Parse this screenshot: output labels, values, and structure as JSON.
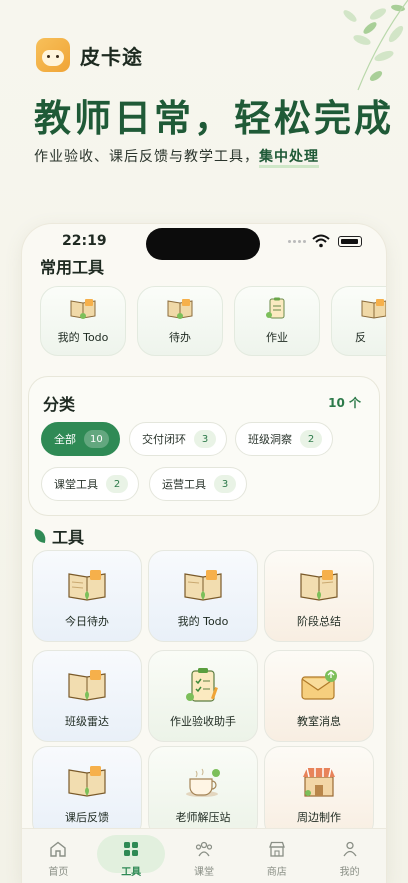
{
  "brand": {
    "name": "皮卡途"
  },
  "hero": {
    "headline": "教师日常，轻松完成",
    "subline_prefix": "作业验收、课后反馈与教学工具，",
    "subline_highlight": "集中处理"
  },
  "status_bar": {
    "time": "22:19"
  },
  "common_tools": {
    "title": "常用工具",
    "items": [
      {
        "label": "我的 Todo",
        "icon": "book-icon"
      },
      {
        "label": "待办",
        "icon": "book-icon"
      },
      {
        "label": "作业",
        "icon": "clipboard-icon"
      },
      {
        "label": "反",
        "icon": "book-icon"
      }
    ]
  },
  "categories": {
    "title": "分类",
    "count_label": "10 个",
    "chips": [
      {
        "label": "全部",
        "count": "10",
        "active": true
      },
      {
        "label": "交付闭环",
        "count": "3"
      },
      {
        "label": "班级洞察",
        "count": "2"
      },
      {
        "label": "课堂工具",
        "count": "2"
      },
      {
        "label": "运营工具",
        "count": "3"
      }
    ]
  },
  "tools": {
    "title": "工具",
    "items": [
      {
        "label": "今日待办",
        "icon": "book-icon"
      },
      {
        "label": "我的 Todo",
        "icon": "book-icon"
      },
      {
        "label": "阶段总结",
        "icon": "book-icon"
      },
      {
        "label": "班级雷达",
        "icon": "book-icon"
      },
      {
        "label": "作业验收助手",
        "icon": "clipboard-icon"
      },
      {
        "label": "教室消息",
        "icon": "envelope-icon"
      },
      {
        "label": "课后反馈",
        "icon": "book-icon"
      },
      {
        "label": "老师解压站",
        "icon": "coffee-cup-icon"
      },
      {
        "label": "周边制作",
        "icon": "shop-icon"
      }
    ]
  },
  "tabbar": {
    "items": [
      {
        "label": "首页",
        "icon": "home-icon"
      },
      {
        "label": "工具",
        "icon": "grid-icon",
        "active": true
      },
      {
        "label": "课堂",
        "icon": "people-icon"
      },
      {
        "label": "商店",
        "icon": "store-icon"
      },
      {
        "label": "我的",
        "icon": "user-icon"
      }
    ]
  },
  "colors": {
    "accent": "#2f8a55",
    "headline": "#1f5a37",
    "chip_bg": "#e9f3e6"
  }
}
